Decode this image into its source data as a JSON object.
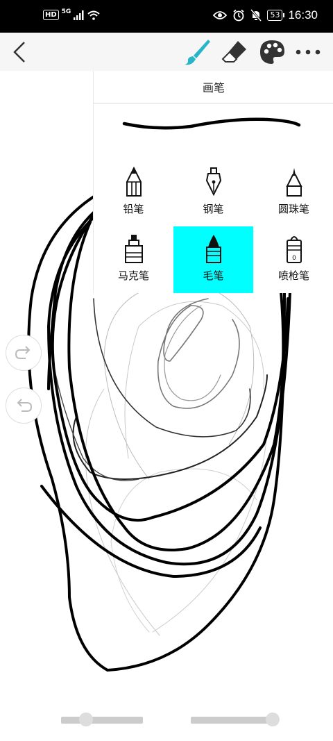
{
  "status_bar": {
    "hd": "HD",
    "network": "5G",
    "battery": "53",
    "time": "16:30"
  },
  "toolbar": {
    "back_icon": "chevron-left-icon",
    "brush_icon": "brush-icon",
    "eraser_icon": "eraser-icon",
    "palette_icon": "palette-icon",
    "more_icon": "more-dots-icon",
    "accent_color": "#27b5c9"
  },
  "pen_panel": {
    "title": "画笔",
    "pens": [
      {
        "label": "铅笔",
        "icon": "pencil-icon",
        "selected": false
      },
      {
        "label": "钢笔",
        "icon": "fountain-pen-icon",
        "selected": false
      },
      {
        "label": "圆珠笔",
        "icon": "ballpoint-pen-icon",
        "selected": false
      },
      {
        "label": "马克笔",
        "icon": "marker-icon",
        "selected": false
      },
      {
        "label": "毛笔",
        "icon": "brush-pen-icon",
        "selected": true
      },
      {
        "label": "喷枪笔",
        "icon": "airbrush-icon",
        "selected": false
      }
    ],
    "selected_color": "#00ffff"
  },
  "side_buttons": {
    "redo_icon": "redo-icon",
    "undo_icon": "undo-icon"
  },
  "sliders": {
    "size_level": 0.22,
    "opacity_level": 1.0
  }
}
